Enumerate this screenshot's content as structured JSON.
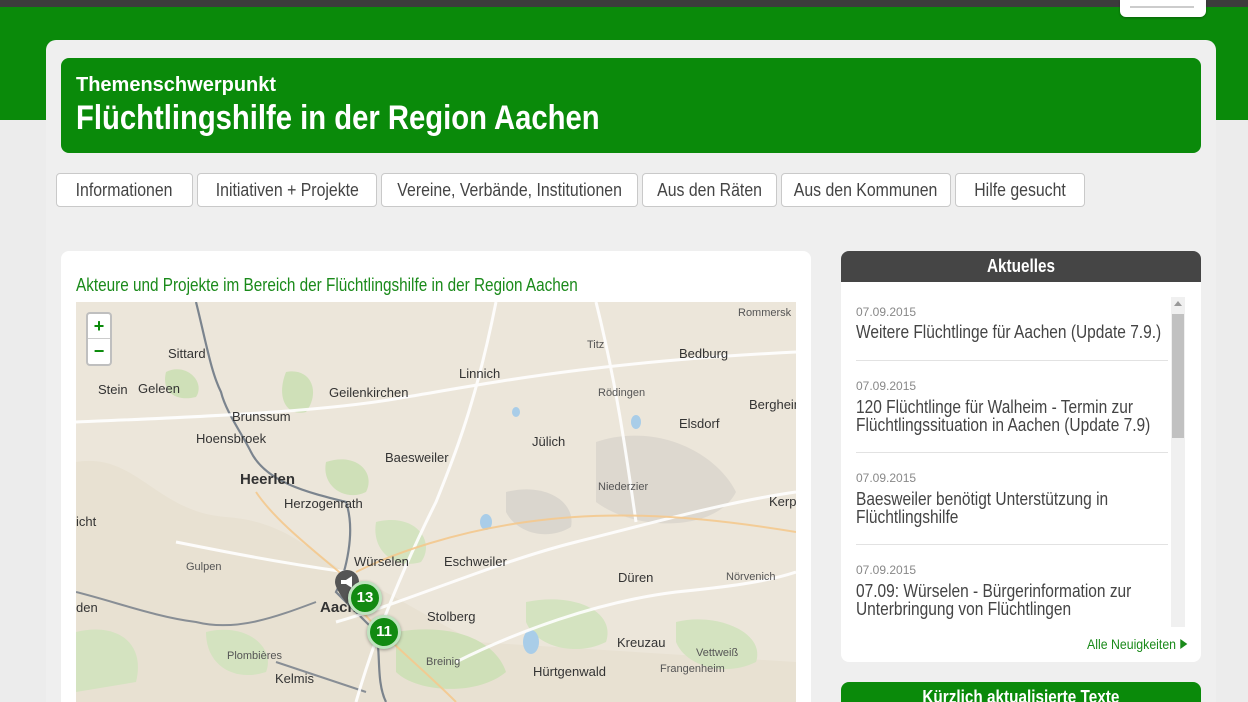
{
  "header": {
    "kicker": "Themenschwerpunkt",
    "title": "Flüchtlingshilfe in der Region Aachen"
  },
  "tabs": [
    {
      "label": "Informationen"
    },
    {
      "label": "Initiativen + Projekte"
    },
    {
      "label": "Vereine, Verbände, Institutionen"
    },
    {
      "label": "Aus den Räten"
    },
    {
      "label": "Aus den Kommunen"
    },
    {
      "label": "Hilfe gesucht"
    }
  ],
  "map_section": {
    "title": "Akteure und Projekte im Bereich der Flüchtlingshilfe in der Region Aachen",
    "zoom_in": "+",
    "zoom_out": "−",
    "places": [
      "Sittard",
      "Stein",
      "Geleen",
      "Brunssum",
      "Hoensbroek",
      "Heerlen",
      "Geilenkirchen",
      "Linnich",
      "Titz",
      "Bedburg",
      "Rommersk",
      "Rödingen",
      "Bergheim",
      "Elsdorf",
      "Jülich",
      "Baesweiler",
      "Niederzier",
      "Herzogenrath",
      "Kerp",
      "Würselen",
      "Eschweiler",
      "Düren",
      "Nörvenich",
      "Gulpen",
      "Aach",
      "Stolberg",
      "Kreuzau",
      "Vettweiß",
      "Frangenheim",
      "Plombières",
      "Breinig",
      "Hürtgenwald",
      "Kelmis",
      "icht",
      "den"
    ],
    "clusters": [
      {
        "count": "13"
      },
      {
        "count": "11"
      }
    ]
  },
  "news": {
    "heading": "Aktuelles",
    "items": [
      {
        "date": "07.09.2015",
        "title_lines": [
          "Weitere Flüchtlinge für Aachen (Update 7.9.)"
        ]
      },
      {
        "date": "07.09.2015",
        "title_lines": [
          "120 Flüchtlinge für Walheim - Termin zur",
          "Flüchtlingssituation in Aachen (Update 7.9)"
        ]
      },
      {
        "date": "07.09.2015",
        "title_lines": [
          "Baesweiler benötigt Unterstützung in",
          "Flüchtlingshilfe"
        ]
      },
      {
        "date": "07.09.2015",
        "title_lines": [
          "07.09: Würselen - Bürgerinformation zur",
          "Unterbringung von Flüchtlingen"
        ]
      }
    ],
    "more_label": "Alle Neuigkeiten"
  },
  "recent": {
    "heading": "Kürzlich aktualisierte Texte"
  },
  "colors": {
    "brand_green": "#0a8a0a",
    "dark_header": "#454545",
    "link_green": "#1a8a1a"
  }
}
